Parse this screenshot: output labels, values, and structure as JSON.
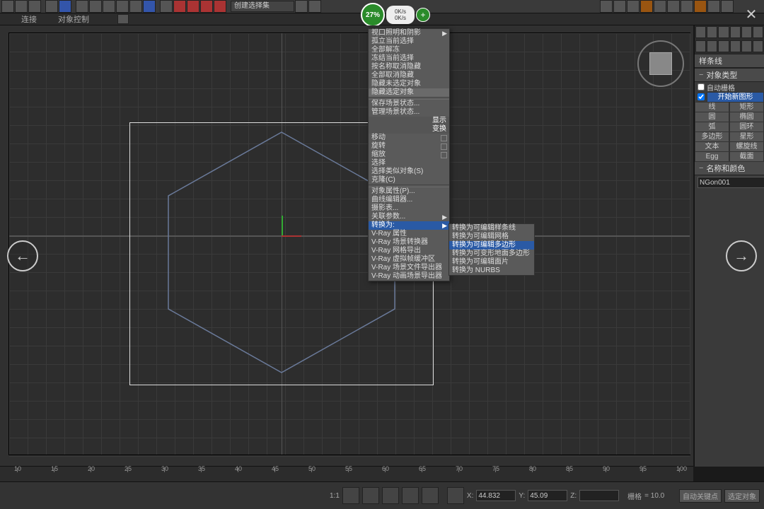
{
  "toolbar": {
    "dropdown": "创建选择集"
  },
  "menu": {
    "item1": "连接",
    "item2": "对象控制"
  },
  "badge": {
    "pct": "27%",
    "rate1": "0K/s",
    "rate2": "0K/s"
  },
  "context_menu": {
    "items": [
      "视口照明和阴影",
      "孤立当前选择",
      "全部解冻",
      "冻结当前选择",
      "按名称取消隐藏",
      "全部取消隐藏",
      "隐藏未选定对象",
      "隐藏选定对象",
      "保存场景状态...",
      "管理场景状态..."
    ],
    "hdr1": "显示",
    "hdr2": "变换",
    "xform": [
      "移动",
      "旋转",
      "缩放",
      "选择",
      "选择类似对象(S)",
      "克隆(C)",
      "对象属性(P)...",
      "曲线编辑器...",
      "摄影表...",
      "关联参数..."
    ],
    "convert": "转换为:",
    "vray": [
      "V-Ray 属性",
      "V-Ray 场景转换器",
      "V-Ray 网格导出",
      "V-Ray 虚拟帧缓冲区",
      "V-Ray 场景文件导出器",
      "V-Ray 动画场景导出器"
    ]
  },
  "submenu": {
    "items": [
      "转换为可编辑样条线",
      "转换为可编辑网格",
      "转换为可编辑多边形",
      "转换为可变形地面多边形",
      "转换为可编辑面片",
      "转换为 NURBS"
    ]
  },
  "right_panel": {
    "title": "样条线",
    "obj_type": "对象类型",
    "auto_grid": "自动栅格",
    "start_new": "开始新图形",
    "shapes": {
      "r0c0": "线",
      "r0c1": "矩形",
      "r1c0": "圆",
      "r1c1": "椭圆",
      "r2c0": "弧",
      "r2c1": "圆环",
      "r3c0": "多边形",
      "r3c1": "星形",
      "r4c0": "文本",
      "r4c1": "螺旋线",
      "r5c0": "Egg",
      "r5c1": "截面"
    },
    "name_color": "名称和颜色",
    "obj_name": "NGon001"
  },
  "ruler": {
    "ticks": [
      "10",
      "15",
      "20",
      "25",
      "30",
      "35",
      "40",
      "45",
      "50",
      "55",
      "60",
      "65",
      "70",
      "75",
      "80",
      "85",
      "90",
      "95",
      "100"
    ]
  },
  "status": {
    "ratio": "1:1",
    "x_lbl": "X:",
    "x": "44.832",
    "y_lbl": "Y:",
    "y": "45.09",
    "z_lbl": "Z:",
    "z": "",
    "grid_lbl": "栅格",
    "grid": "= 10.0",
    "autokey": "自动关键点",
    "selset": "选定对象"
  }
}
